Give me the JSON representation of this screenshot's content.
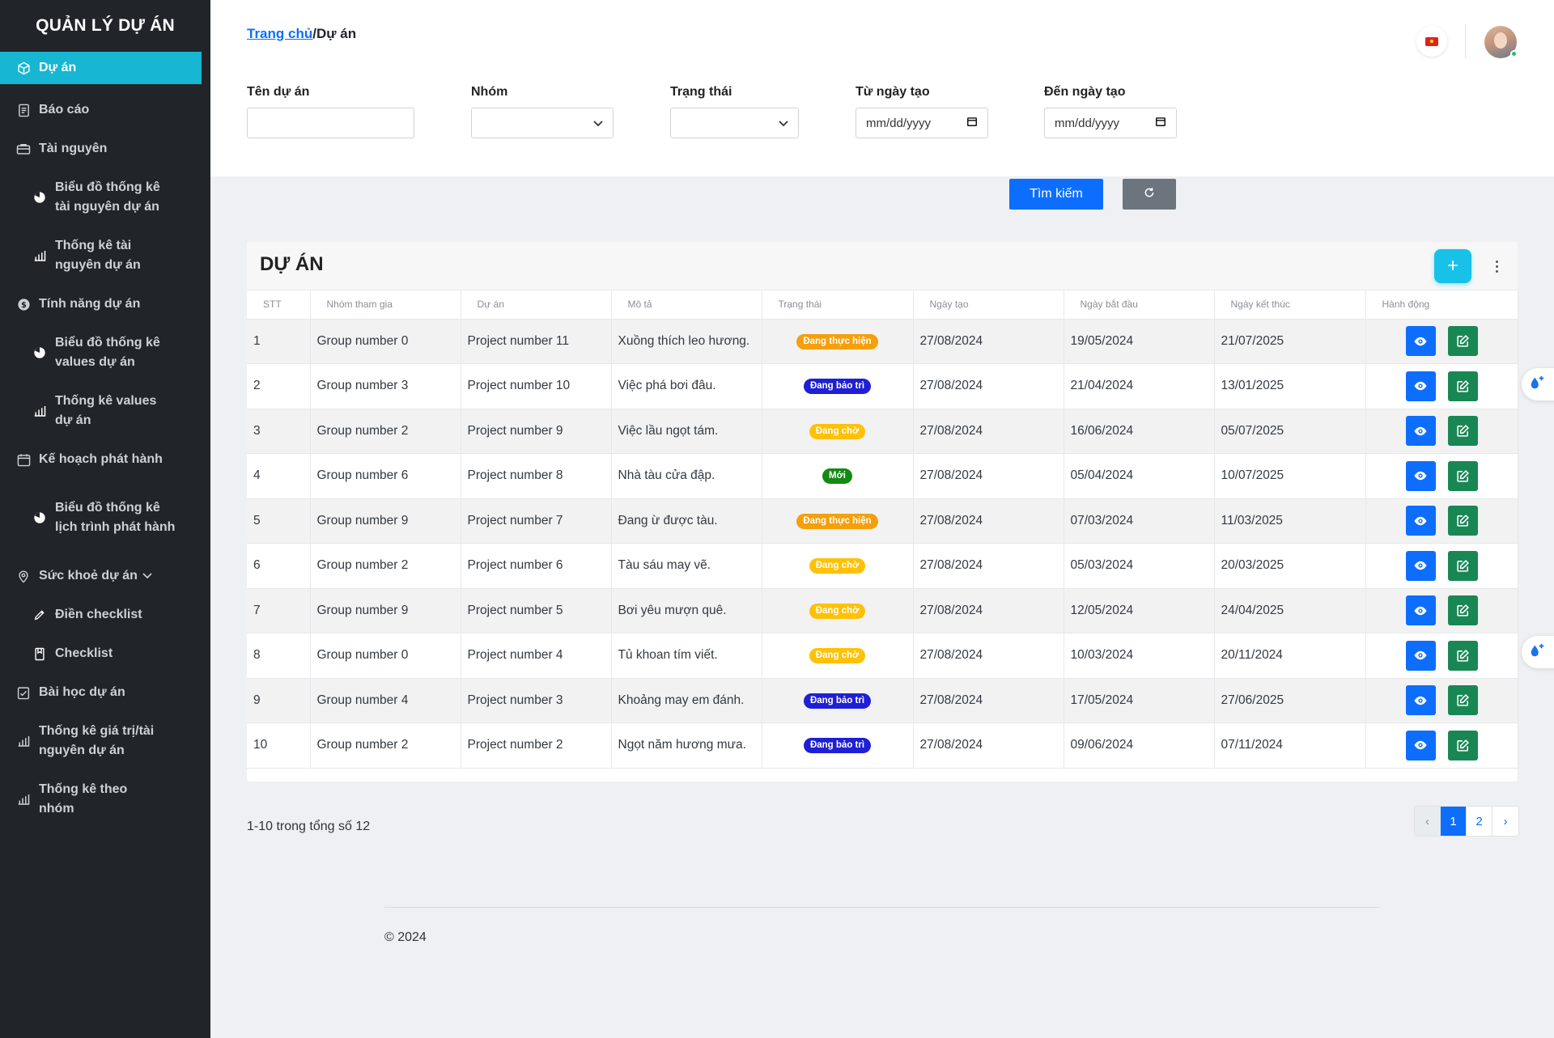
{
  "sidebar": {
    "brand": "QUẢN LÝ DỰ ÁN",
    "items": [
      {
        "label": "Dự án",
        "icon": "cube-icon"
      },
      {
        "label": "Báo cáo",
        "icon": "document-icon"
      },
      {
        "label": "Tài nguyên",
        "icon": "briefcase-icon"
      },
      {
        "label": "Biểu đồ thống kê tài nguyên dự án",
        "icon": "pie-chart-icon"
      },
      {
        "label": "Thống kê tài nguyên dự án",
        "icon": "bar-chart-icon"
      },
      {
        "label": "Tính năng dự án",
        "icon": "dollar-circle-icon"
      },
      {
        "label": "Biểu đồ thống kê values dự án",
        "icon": "pie-chart-icon"
      },
      {
        "label": "Thống kê values dự án",
        "icon": "bar-chart-icon"
      },
      {
        "label": "Kế hoạch phát hành",
        "icon": "calendar-icon"
      },
      {
        "label": "Biểu đồ thống kê lịch trình phát hành",
        "icon": "pie-chart-icon"
      },
      {
        "label": "Sức khoẻ dự án",
        "icon": "map-pin-icon"
      },
      {
        "label": "Điền checklist",
        "icon": "pencil-icon"
      },
      {
        "label": "Checklist",
        "icon": "bookmark-icon"
      },
      {
        "label": "Bài học dự án",
        "icon": "check-square-icon"
      },
      {
        "label": "Thống kê giá trị/tài nguyên dự án",
        "icon": "bar-chart-icon"
      },
      {
        "label": "Thống kê theo nhóm",
        "icon": "bar-chart-icon"
      }
    ]
  },
  "breadcrumb": {
    "home": "Trang chủ",
    "separator": "/",
    "current": "Dự án"
  },
  "filters": {
    "name_label": "Tên dự án",
    "name_value": "",
    "group_label": "Nhóm",
    "group_value": "",
    "status_label": "Trạng thái",
    "status_value": "",
    "from_label": "Từ ngày tạo",
    "from_placeholder": "mm/dd/yyyy",
    "to_label": "Đến ngày tạo",
    "to_placeholder": "mm/dd/yyyy"
  },
  "buttons": {
    "search": "Tìm kiếm"
  },
  "card": {
    "title": "DỰ ÁN",
    "add_label": "+"
  },
  "table": {
    "headers": [
      "STT",
      "Nhóm tham gia",
      "Dự án",
      "Mô tả",
      "Trạng thái",
      "Ngày tạo",
      "Ngày bắt đầu",
      "Ngày kết thúc",
      "Hành động"
    ],
    "rows": [
      {
        "stt": "1",
        "group": "Group number 0",
        "project": "Project number 11",
        "desc": "Xuồng thích leo hương.",
        "status": "Đang thực hiện",
        "created": "27/08/2024",
        "start": "19/05/2024",
        "end": "21/07/2025"
      },
      {
        "stt": "2",
        "group": "Group number 3",
        "project": "Project number 10",
        "desc": "Việc phá bơi đâu.",
        "status": "Đang bảo trì",
        "created": "27/08/2024",
        "start": "21/04/2024",
        "end": "13/01/2025"
      },
      {
        "stt": "3",
        "group": "Group number 2",
        "project": "Project number 9",
        "desc": "Việc lầu ngọt tám.",
        "status": "Đang chờ",
        "created": "27/08/2024",
        "start": "16/06/2024",
        "end": "05/07/2025"
      },
      {
        "stt": "4",
        "group": "Group number 6",
        "project": "Project number 8",
        "desc": "Nhà tàu cửa đập.",
        "status": "Mới",
        "created": "27/08/2024",
        "start": "05/04/2024",
        "end": "10/07/2025"
      },
      {
        "stt": "5",
        "group": "Group number 9",
        "project": "Project number 7",
        "desc": "Đang ừ được tàu.",
        "status": "Đang thực hiện",
        "created": "27/08/2024",
        "start": "07/03/2024",
        "end": "11/03/2025"
      },
      {
        "stt": "6",
        "group": "Group number 2",
        "project": "Project number 6",
        "desc": "Tàu sáu may vẽ.",
        "status": "Đang chờ",
        "created": "27/08/2024",
        "start": "05/03/2024",
        "end": "20/03/2025"
      },
      {
        "stt": "7",
        "group": "Group number 9",
        "project": "Project number 5",
        "desc": "Bơi yêu mượn quê.",
        "status": "Đang chờ",
        "created": "27/08/2024",
        "start": "12/05/2024",
        "end": "24/04/2025"
      },
      {
        "stt": "8",
        "group": "Group number 0",
        "project": "Project number 4",
        "desc": "Tủ khoan tím viết.",
        "status": "Đang chờ",
        "created": "27/08/2024",
        "start": "10/03/2024",
        "end": "20/11/2024"
      },
      {
        "stt": "9",
        "group": "Group number 4",
        "project": "Project number 3",
        "desc": "Khoảng may em đánh.",
        "status": "Đang bảo trì",
        "created": "27/08/2024",
        "start": "17/05/2024",
        "end": "27/06/2025"
      },
      {
        "stt": "10",
        "group": "Group number 2",
        "project": "Project number 2",
        "desc": "Ngọt năm hương mưa.",
        "status": "Đang bảo trì",
        "created": "27/08/2024",
        "start": "09/06/2024",
        "end": "07/11/2024"
      }
    ]
  },
  "status_colors": {
    "Đang thực hiện": "#f59f0b",
    "Đang bảo trì": "#1f1fd6",
    "Đang chờ": "#ffc107",
    "Mới": "#138a13"
  },
  "pagination": {
    "info": "1-10 trong tổng số 12",
    "prev": "‹",
    "pages": [
      "1",
      "2"
    ],
    "current": "1",
    "next": "›"
  },
  "footer": {
    "text": "© 2024"
  },
  "colors": {
    "sidebar_bg": "#212529",
    "active": "#17b6d3",
    "primary": "#0d6efd",
    "success": "#198754",
    "add": "#17c1e8"
  }
}
